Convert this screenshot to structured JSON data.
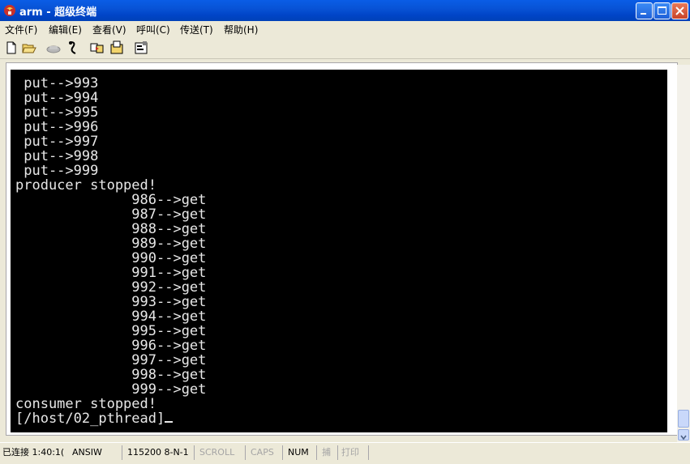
{
  "window": {
    "title": "arm - 超级终端"
  },
  "menu": [
    "文件(F)",
    "编辑(E)",
    "查看(V)",
    "呼叫(C)",
    "传送(T)",
    "帮助(H)"
  ],
  "toolbar_icons": [
    "new-icon",
    "open-icon",
    "disconnect-icon",
    "connect-icon",
    "send-icon",
    "receive-icon",
    "properties-icon"
  ],
  "terminal": {
    "lines": [
      " put-->993",
      " put-->994",
      " put-->995",
      " put-->996",
      " put-->997",
      " put-->998",
      " put-->999",
      "producer stopped!",
      "              986-->get",
      "              987-->get",
      "              988-->get",
      "              989-->get",
      "              990-->get",
      "              991-->get",
      "              992-->get",
      "              993-->get",
      "              994-->get",
      "              995-->get",
      "              996-->get",
      "              997-->get",
      "              998-->get",
      "              999-->get",
      "consumer stopped!",
      "[/host/02_pthread]"
    ]
  },
  "status": {
    "connection": "已连接 1:40:1(",
    "emulation": "ANSIW",
    "port": "115200 8-N-1",
    "scroll": "SCROLL",
    "caps": "CAPS",
    "num": "NUM",
    "capture": "捕",
    "print": "打印"
  },
  "colors": {
    "terminal_bg": "#000000",
    "terminal_fg": "#E8E8E8",
    "titlebar": "#0A5DE6"
  }
}
